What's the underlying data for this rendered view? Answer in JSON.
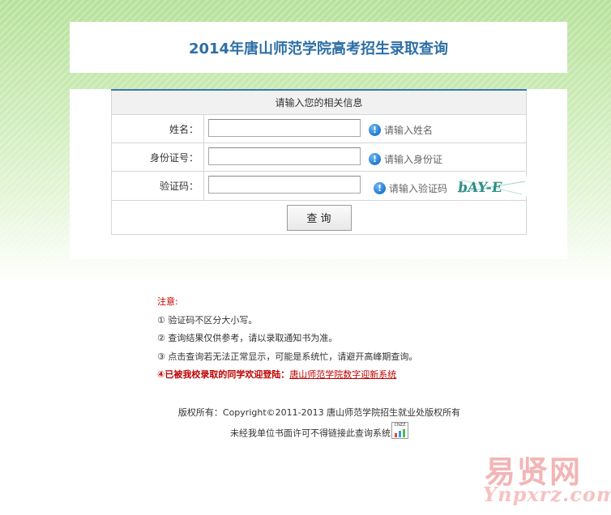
{
  "header": {
    "title": "2014年唐山师范学院高考招生录取查询"
  },
  "form": {
    "heading": "请输入您的相关信息",
    "name_label": "姓名：",
    "name_value": "",
    "name_hint": "请输入姓名",
    "id_label": "身份证号：",
    "id_value": "",
    "id_hint": "请输入身份证",
    "code_label": "验证码：",
    "code_value": "",
    "code_hint": "请输入验证码",
    "captcha_text": "bAY-E",
    "submit_label": "查 询"
  },
  "notes": {
    "title": "注意:",
    "items": [
      "① 验证码不区分大小写。",
      "② 查询结果仅供参考，请以录取通知书为准。",
      "③ 点击查询若无法正常显示，可能是系统忙，请避开高峰期查询。"
    ],
    "welcome_prefix": "④已被我校录取的同学欢迎登陆：",
    "welcome_link": "唐山师范学院数字迎新系统"
  },
  "footer": {
    "copyright": "版权所有：Copyright©2011-2013 唐山师范学院招生就业处版权所有",
    "notice": "未经我单位书面许可不得链接此查询系统",
    "cnzz_label": "CNZZ"
  },
  "watermark": {
    "line1": "易贤网",
    "line2": "Ynpxrz.com"
  },
  "colors": {
    "title_blue": "#2e6fa5",
    "accent_red": "#c00000",
    "bg_green": "#b6e19a",
    "info_blue": "#1f7ad2"
  }
}
